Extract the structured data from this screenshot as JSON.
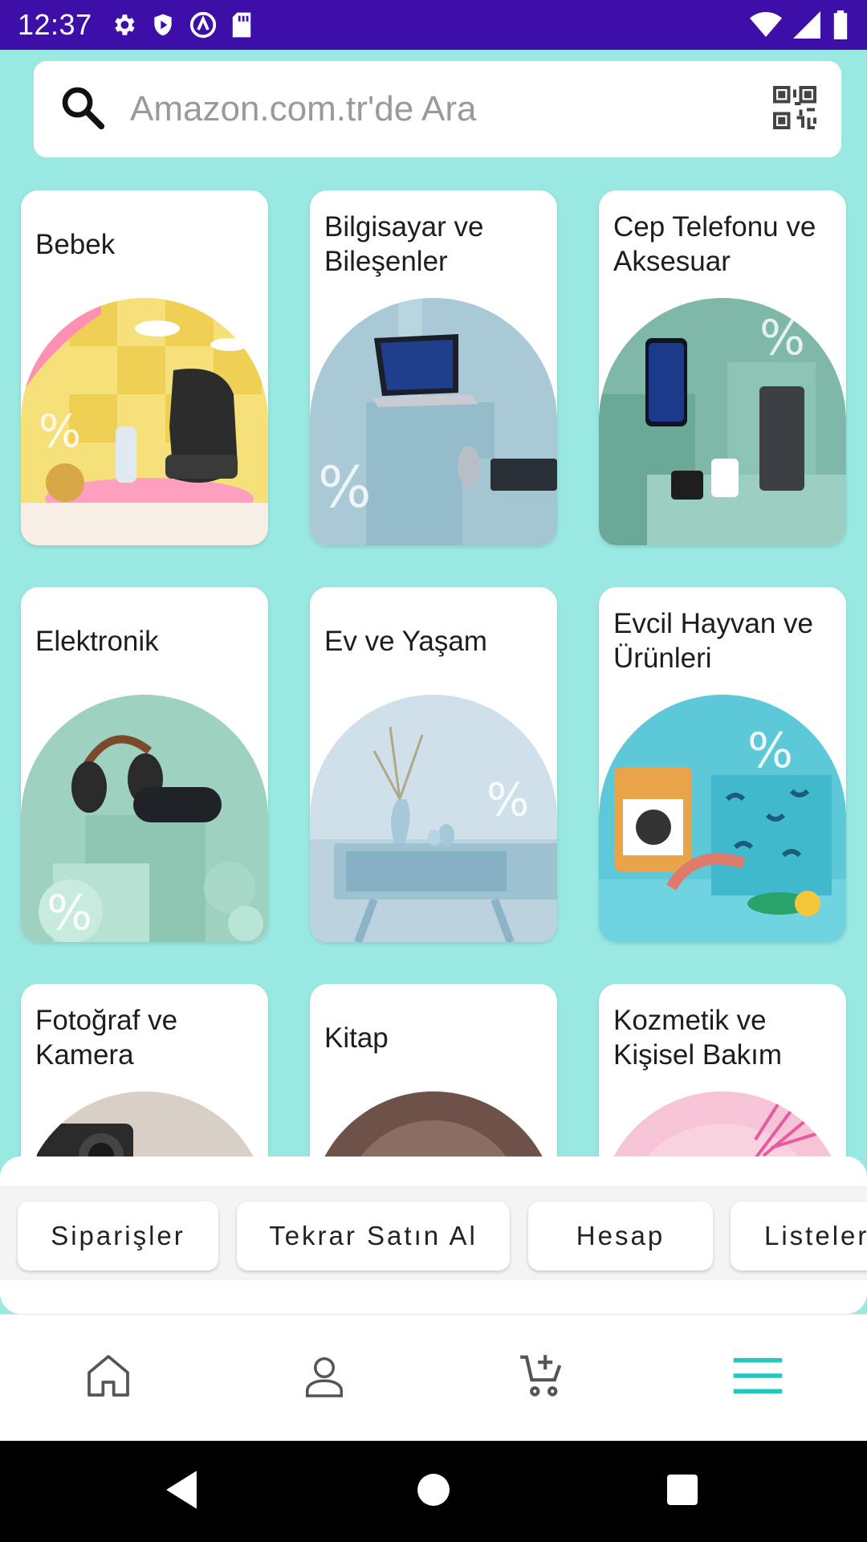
{
  "status_bar": {
    "time": "12:37",
    "icons_left": [
      "gear-icon",
      "shield-icon",
      "at-sign-icon",
      "sd-card-icon"
    ],
    "icons_right": [
      "wifi-icon",
      "cell-signal-icon",
      "battery-icon"
    ]
  },
  "search": {
    "placeholder": "Amazon.com.tr'de Ara",
    "icon": "search-icon",
    "scan_icon": "qr-code-icon"
  },
  "categories": [
    {
      "label": "Bebek",
      "art": "baby-car-seat"
    },
    {
      "label": "Bilgisayar ve Bileşenler",
      "art": "laptop-desk"
    },
    {
      "label": "Cep Telefonu ve Aksesuar",
      "art": "phone-powerbank"
    },
    {
      "label": "Elektronik",
      "art": "headphones-speaker"
    },
    {
      "label": "Ev ve Yaşam",
      "art": "vase-console"
    },
    {
      "label": "Evcil Hayvan ve Ürünleri",
      "art": "dog-food-toys"
    },
    {
      "label": "Fotoğraf ve Kamera",
      "art": "camera"
    },
    {
      "label": "Kitap",
      "art": "book-arch"
    },
    {
      "label": "Kozmetik ve Kişisel Bakım",
      "art": "pink-palm"
    }
  ],
  "quick_actions": [
    {
      "label": "Siparişler"
    },
    {
      "label": "Tekrar Satın Al"
    },
    {
      "label": "Hesap"
    },
    {
      "label": "Listeler"
    }
  ],
  "bottom_nav": {
    "items": [
      "home-icon",
      "account-icon",
      "cart-icon",
      "menu-icon"
    ],
    "active": "menu-icon",
    "active_color": "#1fc8c0",
    "inactive_color": "#555555"
  },
  "colors": {
    "status_bar": "#3d0fa8",
    "background": "#9ae8e2"
  }
}
